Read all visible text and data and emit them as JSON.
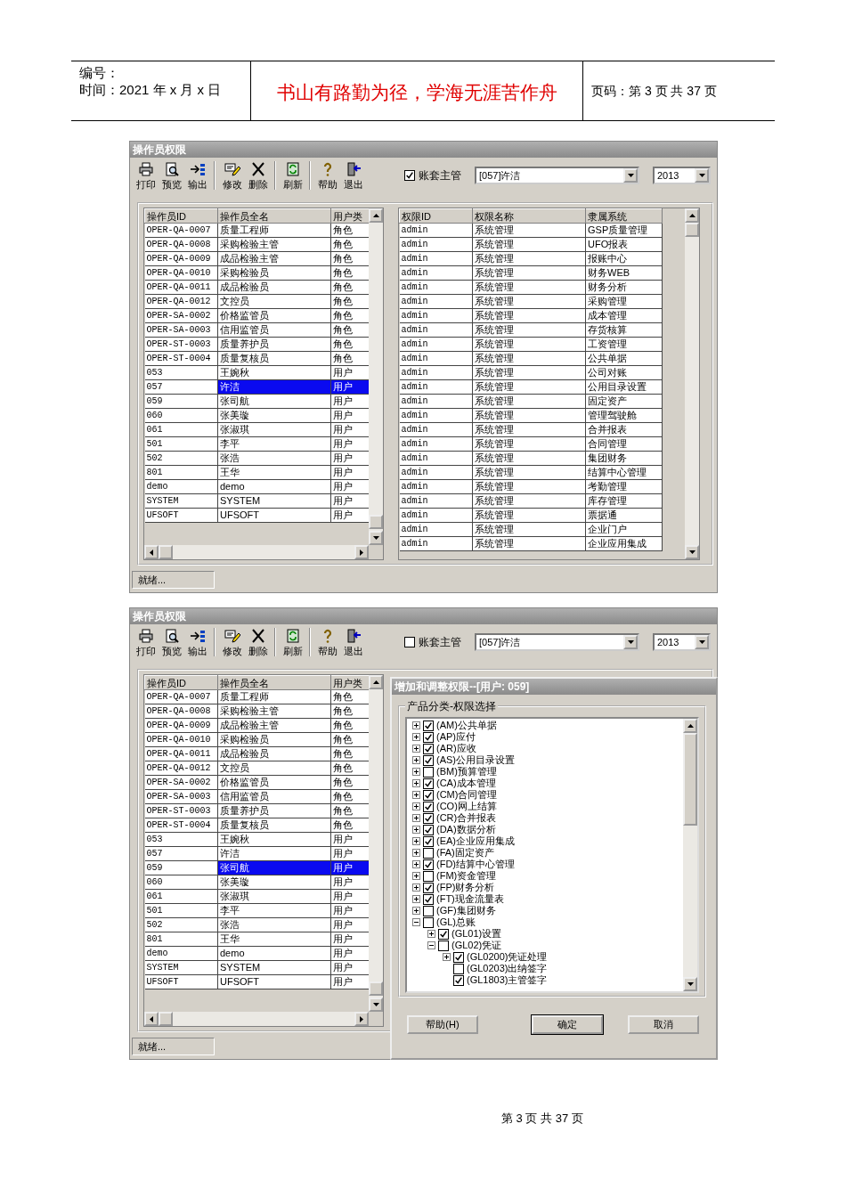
{
  "header": {
    "number_label": "编号：",
    "date": "时间：2021 年 x 月 x 日",
    "motto": "书山有路勤为径，学海无涯苦作舟",
    "page": "页码：第 3 页  共 37 页"
  },
  "screens": [
    {
      "title": "操作员权限",
      "toolbar_groups": [
        {
          "buttons": [
            {
              "kind": "print",
              "label": "打印"
            },
            {
              "kind": "preview",
              "label": "预览"
            },
            {
              "kind": "export",
              "label": "输出"
            }
          ]
        },
        {
          "buttons": [
            {
              "kind": "edit",
              "label": "修改"
            },
            {
              "kind": "delete",
              "label": "删除"
            }
          ]
        },
        {
          "buttons": [
            {
              "kind": "refresh",
              "label": "刷新"
            }
          ]
        },
        {
          "buttons": [
            {
              "kind": "help",
              "label": "帮助"
            },
            {
              "kind": "exit",
              "label": "退出"
            }
          ]
        }
      ],
      "manager_checkbox": {
        "label": "账套主管",
        "checked": true
      },
      "operator_select": "[057]许洁",
      "year_select": "2013",
      "operators": {
        "columns": [
          "操作员ID",
          "操作员全名",
          "用户类"
        ],
        "rows": [
          {
            "cells": [
              "OPER-QA-0007",
              "质量工程师",
              "角色"
            ],
            "selected": false
          },
          {
            "cells": [
              "OPER-QA-0008",
              "采购检验主管",
              "角色"
            ],
            "selected": false
          },
          {
            "cells": [
              "OPER-QA-0009",
              "成品检验主管",
              "角色"
            ],
            "selected": false
          },
          {
            "cells": [
              "OPER-QA-0010",
              "采购检验员",
              "角色"
            ],
            "selected": false
          },
          {
            "cells": [
              "OPER-QA-0011",
              "成品检验员",
              "角色"
            ],
            "selected": false
          },
          {
            "cells": [
              "OPER-QA-0012",
              "文控员",
              "角色"
            ],
            "selected": false
          },
          {
            "cells": [
              "OPER-SA-0002",
              "价格监管员",
              "角色"
            ],
            "selected": false
          },
          {
            "cells": [
              "OPER-SA-0003",
              "信用监管员",
              "角色"
            ],
            "selected": false
          },
          {
            "cells": [
              "OPER-ST-0003",
              "质量养护员",
              "角色"
            ],
            "selected": false
          },
          {
            "cells": [
              "OPER-ST-0004",
              "质量复核员",
              "角色"
            ],
            "selected": false
          },
          {
            "cells": [
              "053",
              "王婉秋",
              "用户"
            ],
            "selected": false
          },
          {
            "cells": [
              "057",
              "许洁",
              "用户"
            ],
            "selected": true
          },
          {
            "cells": [
              "059",
              "张司航",
              "用户"
            ],
            "selected": false
          },
          {
            "cells": [
              "060",
              "张美璇",
              "用户"
            ],
            "selected": false
          },
          {
            "cells": [
              "061",
              "张淑琪",
              "用户"
            ],
            "selected": false
          },
          {
            "cells": [
              "501",
              "李平",
              "用户"
            ],
            "selected": false
          },
          {
            "cells": [
              "502",
              "张浩",
              "用户"
            ],
            "selected": false
          },
          {
            "cells": [
              "801",
              "王华",
              "用户"
            ],
            "selected": false
          },
          {
            "cells": [
              "demo",
              "demo",
              "用户"
            ],
            "selected": false
          },
          {
            "cells": [
              "SYSTEM",
              "SYSTEM",
              "用户"
            ],
            "selected": false
          },
          {
            "cells": [
              "UFSOFT",
              "UFSOFT",
              "用户"
            ],
            "selected": false
          }
        ]
      },
      "permissions": {
        "columns": [
          "权限ID",
          "权限名称",
          "隶属系统"
        ],
        "rows": [
          [
            "admin",
            "系统管理",
            "GSP质量管理"
          ],
          [
            "admin",
            "系统管理",
            "UFO报表"
          ],
          [
            "admin",
            "系统管理",
            "报账中心"
          ],
          [
            "admin",
            "系统管理",
            "财务WEB"
          ],
          [
            "admin",
            "系统管理",
            "财务分析"
          ],
          [
            "admin",
            "系统管理",
            "采购管理"
          ],
          [
            "admin",
            "系统管理",
            "成本管理"
          ],
          [
            "admin",
            "系统管理",
            "存货核算"
          ],
          [
            "admin",
            "系统管理",
            "工资管理"
          ],
          [
            "admin",
            "系统管理",
            "公共单据"
          ],
          [
            "admin",
            "系统管理",
            "公司对账"
          ],
          [
            "admin",
            "系统管理",
            "公用目录设置"
          ],
          [
            "admin",
            "系统管理",
            "固定资产"
          ],
          [
            "admin",
            "系统管理",
            "管理驾驶舱"
          ],
          [
            "admin",
            "系统管理",
            "合并报表"
          ],
          [
            "admin",
            "系统管理",
            "合同管理"
          ],
          [
            "admin",
            "系统管理",
            "集团财务"
          ],
          [
            "admin",
            "系统管理",
            "结算中心管理"
          ],
          [
            "admin",
            "系统管理",
            "考勤管理"
          ],
          [
            "admin",
            "系统管理",
            "库存管理"
          ],
          [
            "admin",
            "系统管理",
            "票据通"
          ],
          [
            "admin",
            "系统管理",
            "企业门户"
          ],
          [
            "admin",
            "系统管理",
            "企业应用集成"
          ]
        ]
      },
      "status": "就绪..."
    },
    {
      "title": "操作员权限",
      "toolbar_groups": [
        {
          "buttons": [
            {
              "kind": "print",
              "label": "打印"
            },
            {
              "kind": "preview",
              "label": "预览"
            },
            {
              "kind": "export",
              "label": "输出"
            }
          ]
        },
        {
          "buttons": [
            {
              "kind": "edit",
              "label": "修改"
            },
            {
              "kind": "delete",
              "label": "删除"
            }
          ]
        },
        {
          "buttons": [
            {
              "kind": "refresh",
              "label": "刷新"
            }
          ]
        },
        {
          "buttons": [
            {
              "kind": "help",
              "label": "帮助"
            },
            {
              "kind": "exit",
              "label": "退出"
            }
          ]
        }
      ],
      "manager_checkbox": {
        "label": "账套主管",
        "checked": false
      },
      "operator_select": "[057]许洁",
      "year_select": "2013",
      "operators": {
        "columns": [
          "操作员ID",
          "操作员全名",
          "用户类"
        ],
        "rows": [
          {
            "cells": [
              "OPER-QA-0007",
              "质量工程师",
              "角色"
            ],
            "selected": false
          },
          {
            "cells": [
              "OPER-QA-0008",
              "采购检验主管",
              "角色"
            ],
            "selected": false
          },
          {
            "cells": [
              "OPER-QA-0009",
              "成品检验主管",
              "角色"
            ],
            "selected": false
          },
          {
            "cells": [
              "OPER-QA-0010",
              "采购检验员",
              "角色"
            ],
            "selected": false
          },
          {
            "cells": [
              "OPER-QA-0011",
              "成品检验员",
              "角色"
            ],
            "selected": false
          },
          {
            "cells": [
              "OPER-QA-0012",
              "文控员",
              "角色"
            ],
            "selected": false
          },
          {
            "cells": [
              "OPER-SA-0002",
              "价格监管员",
              "角色"
            ],
            "selected": false
          },
          {
            "cells": [
              "OPER-SA-0003",
              "信用监管员",
              "角色"
            ],
            "selected": false
          },
          {
            "cells": [
              "OPER-ST-0003",
              "质量养护员",
              "角色"
            ],
            "selected": false
          },
          {
            "cells": [
              "OPER-ST-0004",
              "质量复核员",
              "角色"
            ],
            "selected": false
          },
          {
            "cells": [
              "053",
              "王婉秋",
              "用户"
            ],
            "selected": false
          },
          {
            "cells": [
              "057",
              "许洁",
              "用户"
            ],
            "selected": false
          },
          {
            "cells": [
              "059",
              "张司航",
              "用户"
            ],
            "selected": true
          },
          {
            "cells": [
              "060",
              "张美璇",
              "用户"
            ],
            "selected": false
          },
          {
            "cells": [
              "061",
              "张淑琪",
              "用户"
            ],
            "selected": false
          },
          {
            "cells": [
              "501",
              "李平",
              "用户"
            ],
            "selected": false
          },
          {
            "cells": [
              "502",
              "张浩",
              "用户"
            ],
            "selected": false
          },
          {
            "cells": [
              "801",
              "王华",
              "用户"
            ],
            "selected": false
          },
          {
            "cells": [
              "demo",
              "demo",
              "用户"
            ],
            "selected": false
          },
          {
            "cells": [
              "SYSTEM",
              "SYSTEM",
              "用户"
            ],
            "selected": false
          },
          {
            "cells": [
              "UFSOFT",
              "UFSOFT",
              "用户"
            ],
            "selected": false
          }
        ]
      },
      "dialog": {
        "title": "增加和调整权限--[用户: 059]",
        "group_label": "产品分类-权限选择",
        "tree": [
          {
            "label": "(AM)公共单据",
            "checked": true,
            "expanded": false
          },
          {
            "label": "(AP)应付",
            "checked": true,
            "expanded": false
          },
          {
            "label": "(AR)应收",
            "checked": true,
            "expanded": false
          },
          {
            "label": "(AS)公用目录设置",
            "checked": true,
            "expanded": false
          },
          {
            "label": "(BM)预算管理",
            "checked": false,
            "expanded": false
          },
          {
            "label": "(CA)成本管理",
            "checked": true,
            "expanded": false
          },
          {
            "label": "(CM)合同管理",
            "checked": true,
            "expanded": false
          },
          {
            "label": "(CO)网上结算",
            "checked": true,
            "expanded": false
          },
          {
            "label": "(CR)合并报表",
            "checked": true,
            "expanded": false
          },
          {
            "label": "(DA)数据分析",
            "checked": true,
            "expanded": false
          },
          {
            "label": "(EA)企业应用集成",
            "checked": true,
            "expanded": false
          },
          {
            "label": "(FA)固定资产",
            "checked": false,
            "expanded": false
          },
          {
            "label": "(FD)结算中心管理",
            "checked": true,
            "expanded": false
          },
          {
            "label": "(FM)资金管理",
            "checked": false,
            "expanded": false
          },
          {
            "label": "(FP)财务分析",
            "checked": true,
            "expanded": false
          },
          {
            "label": "(FT)现金流量表",
            "checked": true,
            "expanded": false
          },
          {
            "label": "(GF)集团财务",
            "checked": false,
            "expanded": false
          },
          {
            "label": "(GL)总账",
            "checked": false,
            "expanded": true,
            "children": [
              {
                "label": "(GL01)设置",
                "checked": true,
                "expanded": false
              },
              {
                "label": "(GL02)凭证",
                "checked": false,
                "expanded": true,
                "children": [
                  {
                    "kind": "branch",
                    "label": "(GL0200)凭证处理",
                    "checked": true,
                    "expanded": false
                  },
                  {
                    "kind": "leaf",
                    "label": "(GL0203)出纳签字",
                    "checked": false
                  },
                  {
                    "kind": "leaf",
                    "label": "(GL1803)主管签字",
                    "checked": true
                  }
                ]
              }
            ]
          }
        ],
        "buttons": [
          {
            "label": "帮助(H)",
            "default": false
          },
          {
            "label": "确定",
            "default": true
          },
          {
            "label": "取消",
            "default": false
          }
        ]
      },
      "status": "就绪..."
    }
  ],
  "footer": "第 3 页 共 37 页"
}
